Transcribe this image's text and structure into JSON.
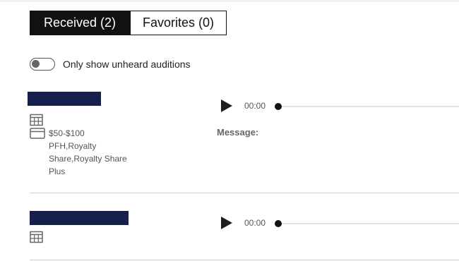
{
  "tabs": [
    {
      "label": "Received (2)",
      "active": true
    },
    {
      "label": "Favorites (0)",
      "active": false
    }
  ],
  "filter": {
    "toggle_label": "Only show unheard auditions",
    "enabled": false
  },
  "auditions": [
    {
      "time": "00:00",
      "price": "$50-$100",
      "rights": "PFH,Royalty Share,Royalty Share Plus",
      "message_label": "Message:"
    },
    {
      "time": "00:00"
    }
  ],
  "colors": {
    "name_bar": "#15204d",
    "tab_active_bg": "#111111"
  },
  "icons": [
    "calendar-icon",
    "card-icon",
    "play-icon"
  ]
}
